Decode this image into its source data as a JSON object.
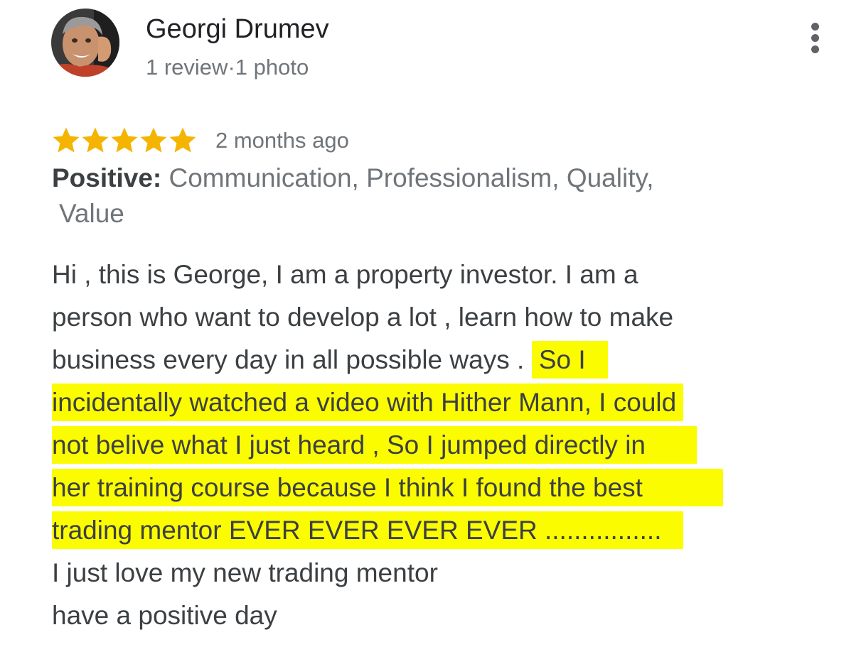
{
  "reviewer": {
    "name": "Georgi Drumev",
    "review_count": "1 review",
    "separator": "·",
    "photo_count": "1 photo"
  },
  "review": {
    "rating": 5,
    "rating_max": 5,
    "time": "2 months ago",
    "attributes_label": "Positive:",
    "attributes_line1": "Communication, Professionalism, Quality,",
    "attributes_line2": "Value",
    "text_lines": [
      "Hi , this is George, I am a property investor. I am a",
      "person who want to develop a lot , learn how to make",
      "business every day in all possible ways .",
      "So I",
      "incidentally watched a video with Hither Mann, I could",
      "not belive what I just heard , So I jumped directly in",
      "her training course because I think I found the best",
      "trading mentor EVER EVER EVER EVER ................",
      "I just love my new trading mentor",
      "have a positive day"
    ]
  },
  "icons": {
    "avatar": "avatar-photo",
    "star": "star-icon",
    "more": "more-vert-icon"
  },
  "colors": {
    "star": "#f4b400",
    "highlight": "#fcfc00",
    "name": "#202124",
    "secondary": "#70757a",
    "body": "#3c4043"
  }
}
